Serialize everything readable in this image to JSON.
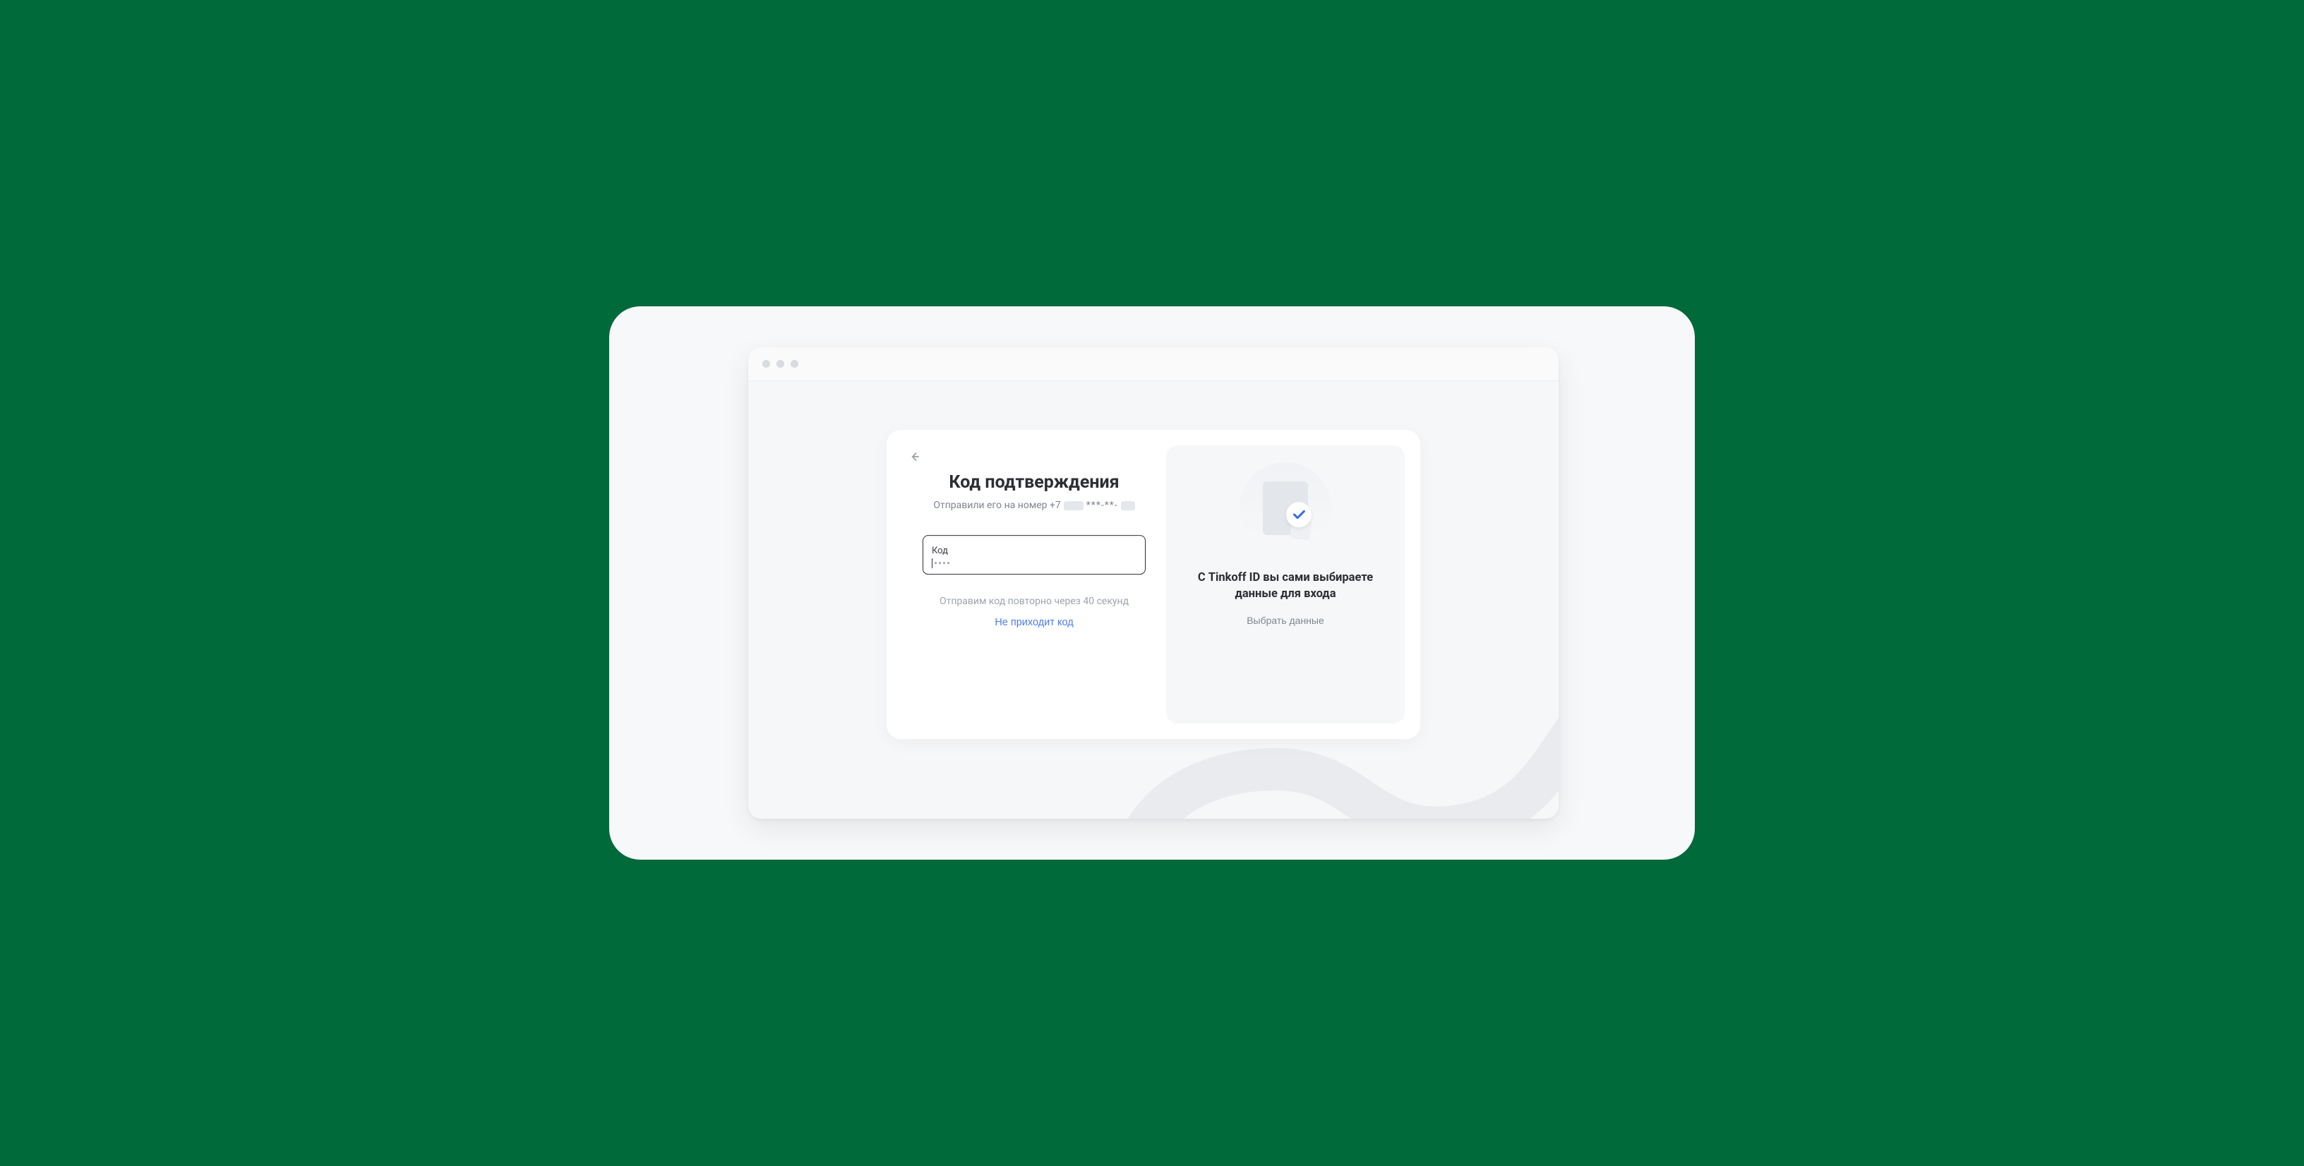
{
  "left": {
    "title": "Код подтверждения",
    "subtitle_prefix": "Отправили его на номер +7",
    "subtitle_stars": "***-**-",
    "code_label": "Код",
    "resend_text": "Отправим код повторно через 40 секунд",
    "no_code_link": "Не приходит код"
  },
  "right": {
    "promo_title": "С Tinkoff ID вы сами выбираете данные для входа",
    "promo_action": "Выбрать данные"
  }
}
